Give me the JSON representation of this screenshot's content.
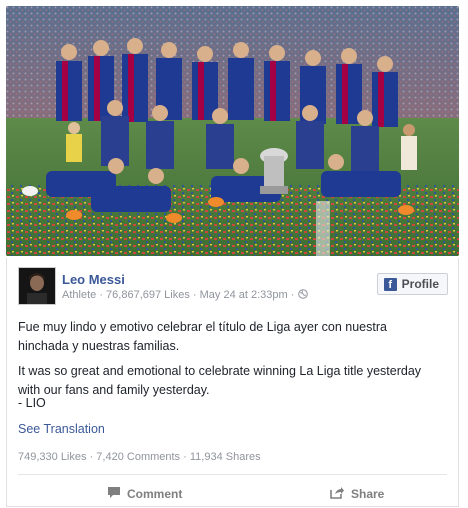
{
  "post": {
    "author": "Leo Messi",
    "category": "Athlete",
    "likes_count": "76,867,697 Likes",
    "date": "May 24 at 2:33pm",
    "profile_label": "Profile",
    "text_es": "Fue muy lindo y emotivo celebrar el título de Liga ayer con nuestra hinchada y nuestras familias.",
    "text_en": "It was so great and emotional to celebrate winning La Liga title yesterday with our fans and family yesterday.",
    "signoff": "- LIO",
    "see_translation": "See Translation",
    "stats": {
      "likes": "749,330 Likes",
      "comments": "7,420 Comments",
      "shares": "11,934 Shares"
    },
    "actions": {
      "comment": "Comment",
      "share": "Share"
    }
  },
  "colors": {
    "brand": "#3b5998",
    "muted": "#90949c",
    "jersey_blue": "#1f3a93",
    "jersey_red": "#a50044"
  }
}
